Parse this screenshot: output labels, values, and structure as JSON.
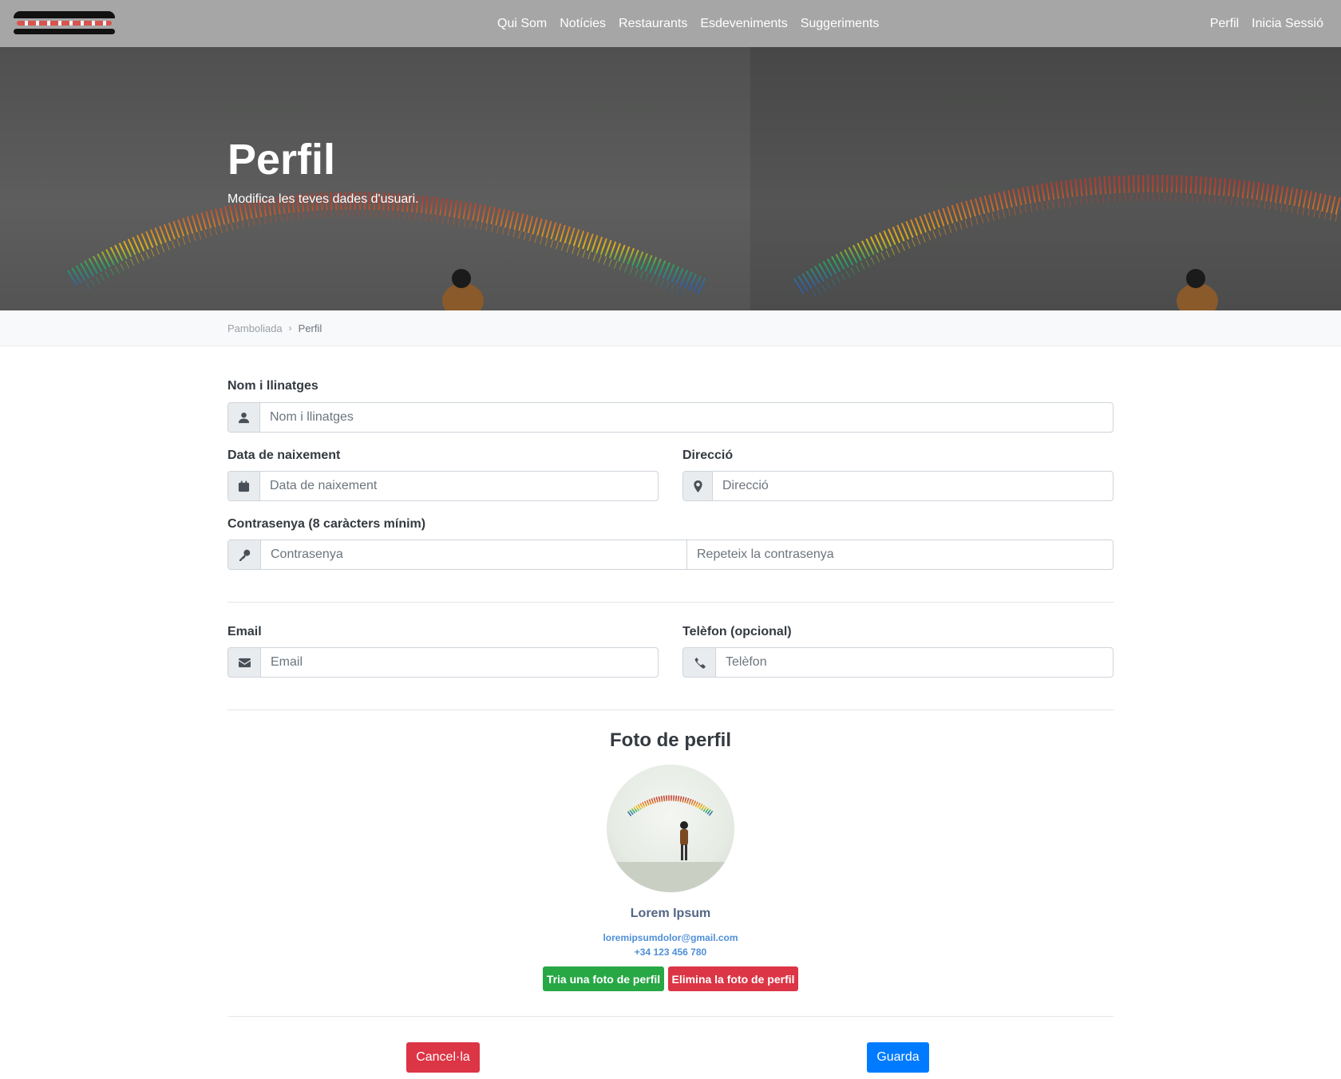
{
  "nav": {
    "links": [
      "Qui Som",
      "Notícies",
      "Restaurants",
      "Esdeveniments",
      "Suggeriments"
    ],
    "right_links": [
      "Perfil",
      "Inicia Sessió"
    ]
  },
  "hero": {
    "title": "Perfil",
    "subtitle": "Modifica les teves dades d'usuari."
  },
  "breadcrumb": {
    "home": "Pamboliada",
    "current": "Perfil"
  },
  "form": {
    "name": {
      "label": "Nom i llinatges",
      "placeholder": "Nom i llinatges",
      "icon": "user-icon"
    },
    "birthdate": {
      "label": "Data de naixement",
      "placeholder": "Data de naixement",
      "icon": "calendar-icon"
    },
    "address": {
      "label": "Direcció",
      "placeholder": "Direcció",
      "icon": "map-marker-icon"
    },
    "password": {
      "label": "Contrasenya (8 caràcters mínim)",
      "placeholder": "Contrasenya",
      "repeat_placeholder": "Repeteix la contrasenya",
      "icon": "key-icon"
    },
    "email": {
      "label": "Email",
      "placeholder": "Email",
      "icon": "envelope-icon"
    },
    "phone": {
      "label": "Telèfon (opcional)",
      "placeholder": "Telèfon",
      "icon": "phone-icon"
    }
  },
  "profile": {
    "title": "Foto de perfil",
    "name": "Lorem Ipsum",
    "email": "loremipsumdolor@gmail.com",
    "phone": "+34 123 456 780",
    "choose_label": "Tria una foto de perfil",
    "delete_label": "Elimina la foto de perfil"
  },
  "actions": {
    "cancel_label": "Cancel·la",
    "save_label": "Guarda"
  },
  "colors": {
    "navbar": "#a6a6a6",
    "success": "#28a745",
    "danger": "#dc3545",
    "primary": "#007bff"
  }
}
